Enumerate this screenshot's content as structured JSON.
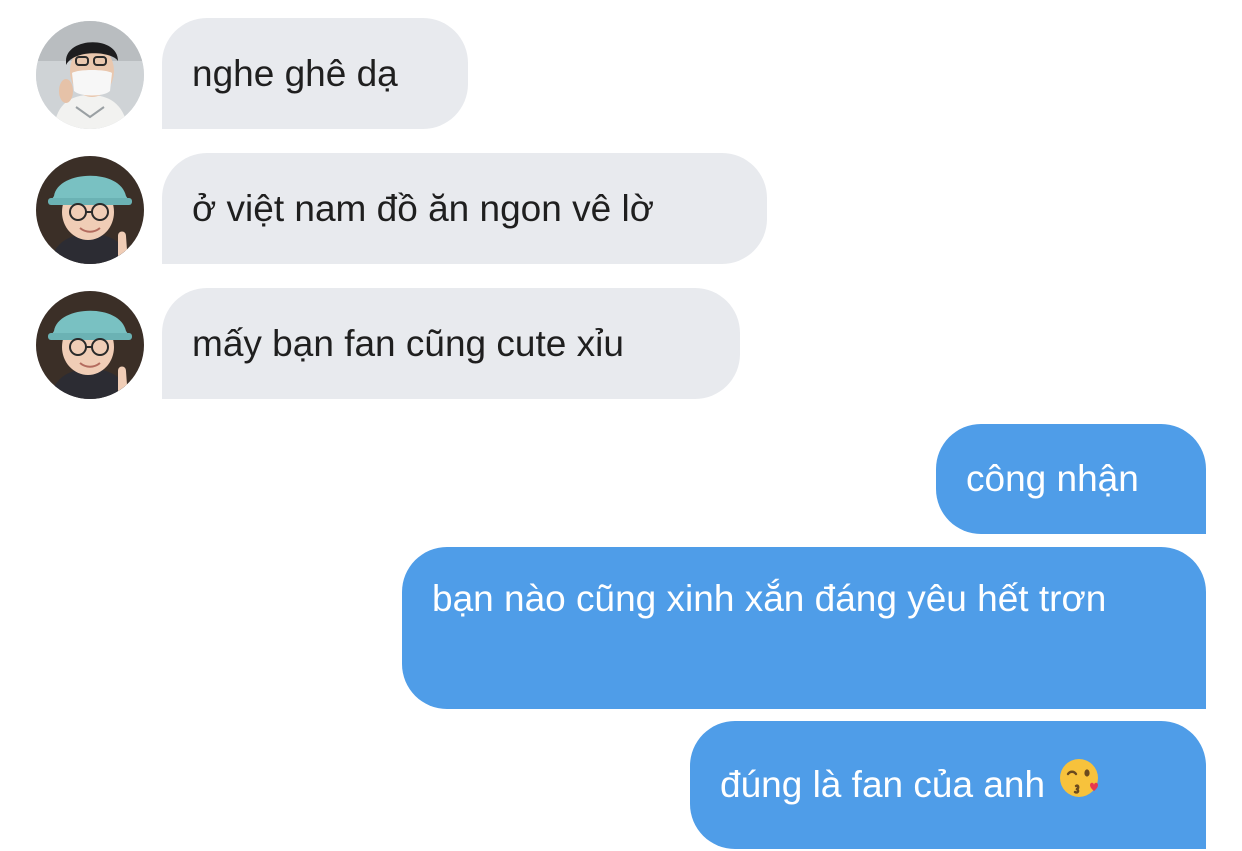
{
  "conversation": {
    "messages": [
      {
        "direction": "incoming",
        "sender_avatar": "avatar-masked-person",
        "text": "nghe ghê dạ"
      },
      {
        "direction": "incoming",
        "sender_avatar": "avatar-bucket-hat-person",
        "text": "ở việt nam đồ ăn ngon vê lờ"
      },
      {
        "direction": "incoming",
        "sender_avatar": "avatar-bucket-hat-person",
        "text": "mấy bạn fan cũng cute xỉu"
      },
      {
        "direction": "outgoing",
        "text": "công nhận"
      },
      {
        "direction": "outgoing",
        "text": "bạn nào cũng xinh xắn đáng yêu hết trơn"
      },
      {
        "direction": "outgoing",
        "text": "đúng là fan của anh",
        "emoji": "kissing-face-winking-icon"
      }
    ]
  },
  "colors": {
    "incoming_bubble": "#e8eaee",
    "outgoing_bubble": "#4f9de8",
    "incoming_text": "#1f1f1f",
    "outgoing_text": "#ffffff"
  }
}
